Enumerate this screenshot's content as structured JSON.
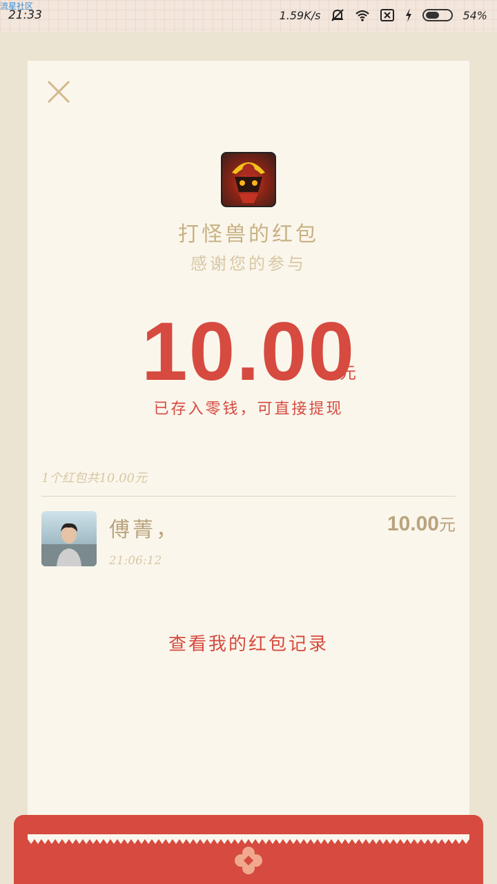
{
  "watermark": "流星社区",
  "status_bar": {
    "time": "21:33",
    "network_speed": "1.59K/s",
    "battery_percent": "54%",
    "battery_level": 0.54,
    "icons": [
      "mute-bell-icon",
      "wifi-icon",
      "sim-x-icon",
      "charging-icon",
      "battery-icon"
    ]
  },
  "envelope": {
    "close_icon": "close-icon",
    "sender_title": "打怪兽的红包",
    "subtitle": "感谢您的参与",
    "amount": "10.00",
    "unit": "元",
    "note": "已存入零钱，可直接提现"
  },
  "summary": "1个红包共10.00元",
  "recipients": [
    {
      "name": "傅菁，",
      "time": "21:06:12",
      "amount": "10.00",
      "unit": "元"
    }
  ],
  "history_link": "查看我的红包记录",
  "colors": {
    "accent_red": "#d64a3f",
    "gold": "#b9a37d",
    "light_gold": "#d8c7a4",
    "card_bg": "#faf6ec",
    "page_bg": "#ece4d2"
  }
}
